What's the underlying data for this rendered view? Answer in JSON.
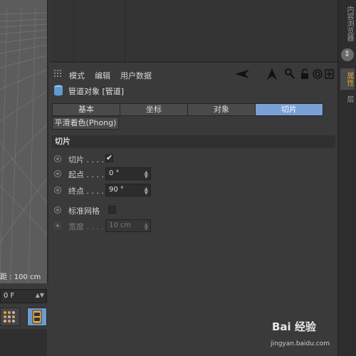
{
  "viewport": {
    "distance_label": "距 : 100 cm"
  },
  "timeline": {
    "frame_value": "0 F"
  },
  "right_tabs": {
    "content_browser": "内容浏览器",
    "attributes": "属性",
    "layers": "层"
  },
  "attributes_panel": {
    "menu": {
      "mode": "模式",
      "edit": "编辑",
      "user_data": "用户数据"
    },
    "object_title": "管道对象 [管道]",
    "tabs": [
      {
        "label": "基本"
      },
      {
        "label": "坐标"
      },
      {
        "label": "对象"
      },
      {
        "label": "切片"
      }
    ],
    "phong_tab": "平滑着色(Phong)",
    "section_title": "切片",
    "props": {
      "slice": {
        "label": "切片 . . . ."
      },
      "start": {
        "label": "起点 . . . .",
        "value": "0 °"
      },
      "end": {
        "label": "终点 . . . .",
        "value": "90 °"
      },
      "regular_grid": {
        "label": "标准网格"
      },
      "width": {
        "label": "宽度 . . . .",
        "value": "10 cm"
      }
    }
  },
  "watermark": {
    "brand": "Bai 经验",
    "url": "jingyan.baidu.com"
  },
  "colors": {
    "active_tab": "#7aa0d6",
    "accent_orange": "#e0a040"
  }
}
